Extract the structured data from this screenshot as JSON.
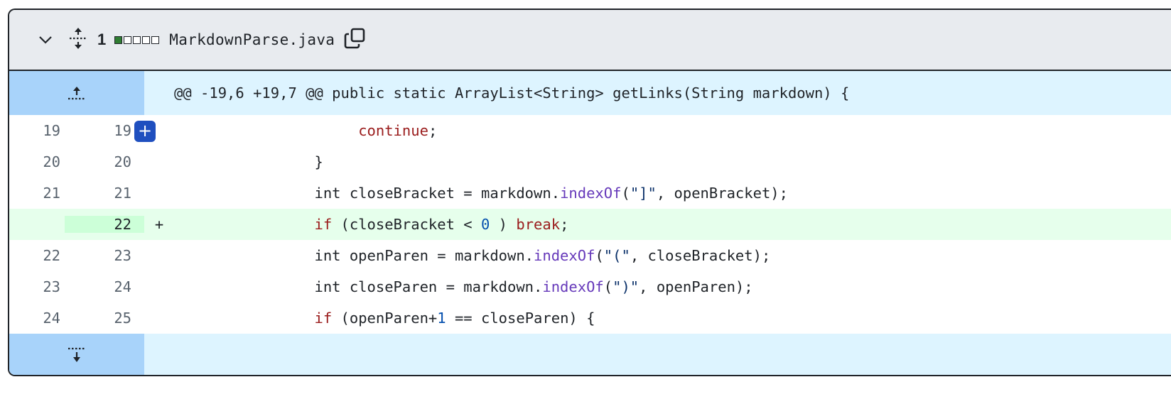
{
  "file": {
    "change_count": "1",
    "name": "MarkdownParse.java",
    "diffstat": [
      "add",
      "neutral",
      "neutral",
      "neutral",
      "neutral"
    ],
    "icons": {
      "collapse": "chevron-down-icon",
      "expand_all": "unfold-icon",
      "copy": "copy-icon",
      "expand_up": "expand-up-icon",
      "expand_down": "expand-down-icon",
      "add_comment": "plus-icon"
    }
  },
  "hunk_header": "@@ -19,6 +19,7 @@ public static ArrayList<String> getLinks(String markdown) {",
  "colors": {
    "keyword": "#9a1c1c",
    "method": "#6639ba",
    "number": "#0550ae",
    "string": "#0a3069",
    "added_bg": "#e6ffec",
    "hunk_bg": "#ddf4ff",
    "comment_button": "#1f4fbf"
  },
  "lines": [
    {
      "old": "19",
      "new": "19",
      "marker": "",
      "tokens": [
        {
          "t": "                     ",
          "c": "pl"
        },
        {
          "t": "continue",
          "c": "kw"
        },
        {
          "t": ";",
          "c": "pl"
        }
      ]
    },
    {
      "old": "20",
      "new": "20",
      "marker": "",
      "tokens": [
        {
          "t": "                }",
          "c": "pl"
        }
      ]
    },
    {
      "old": "21",
      "new": "21",
      "marker": "",
      "tokens": [
        {
          "t": "                int closeBracket = markdown.",
          "c": "pl"
        },
        {
          "t": "indexOf",
          "c": "fn"
        },
        {
          "t": "(",
          "c": "pl"
        },
        {
          "t": "\"]\"",
          "c": "st"
        },
        {
          "t": ", openBracket);",
          "c": "pl"
        }
      ]
    },
    {
      "old": "",
      "new": "22",
      "marker": "+",
      "tokens": [
        {
          "t": "                ",
          "c": "pl"
        },
        {
          "t": "if",
          "c": "kw"
        },
        {
          "t": " (closeBracket < ",
          "c": "pl"
        },
        {
          "t": "0",
          "c": "nm"
        },
        {
          "t": " ) ",
          "c": "pl"
        },
        {
          "t": "break",
          "c": "kw"
        },
        {
          "t": ";",
          "c": "pl"
        }
      ]
    },
    {
      "old": "22",
      "new": "23",
      "marker": "",
      "tokens": [
        {
          "t": "                int openParen = markdown.",
          "c": "pl"
        },
        {
          "t": "indexOf",
          "c": "fn"
        },
        {
          "t": "(",
          "c": "pl"
        },
        {
          "t": "\"(\"",
          "c": "st"
        },
        {
          "t": ", closeBracket);",
          "c": "pl"
        }
      ]
    },
    {
      "old": "23",
      "new": "24",
      "marker": "",
      "tokens": [
        {
          "t": "                int closeParen = markdown.",
          "c": "pl"
        },
        {
          "t": "indexOf",
          "c": "fn"
        },
        {
          "t": "(",
          "c": "pl"
        },
        {
          "t": "\")\"",
          "c": "st"
        },
        {
          "t": ", openParen);",
          "c": "pl"
        }
      ]
    },
    {
      "old": "24",
      "new": "25",
      "marker": "",
      "tokens": [
        {
          "t": "                ",
          "c": "pl"
        },
        {
          "t": "if",
          "c": "kw"
        },
        {
          "t": " (openParen+",
          "c": "pl"
        },
        {
          "t": "1",
          "c": "nm"
        },
        {
          "t": " == closeParen) {",
          "c": "pl"
        }
      ]
    }
  ]
}
